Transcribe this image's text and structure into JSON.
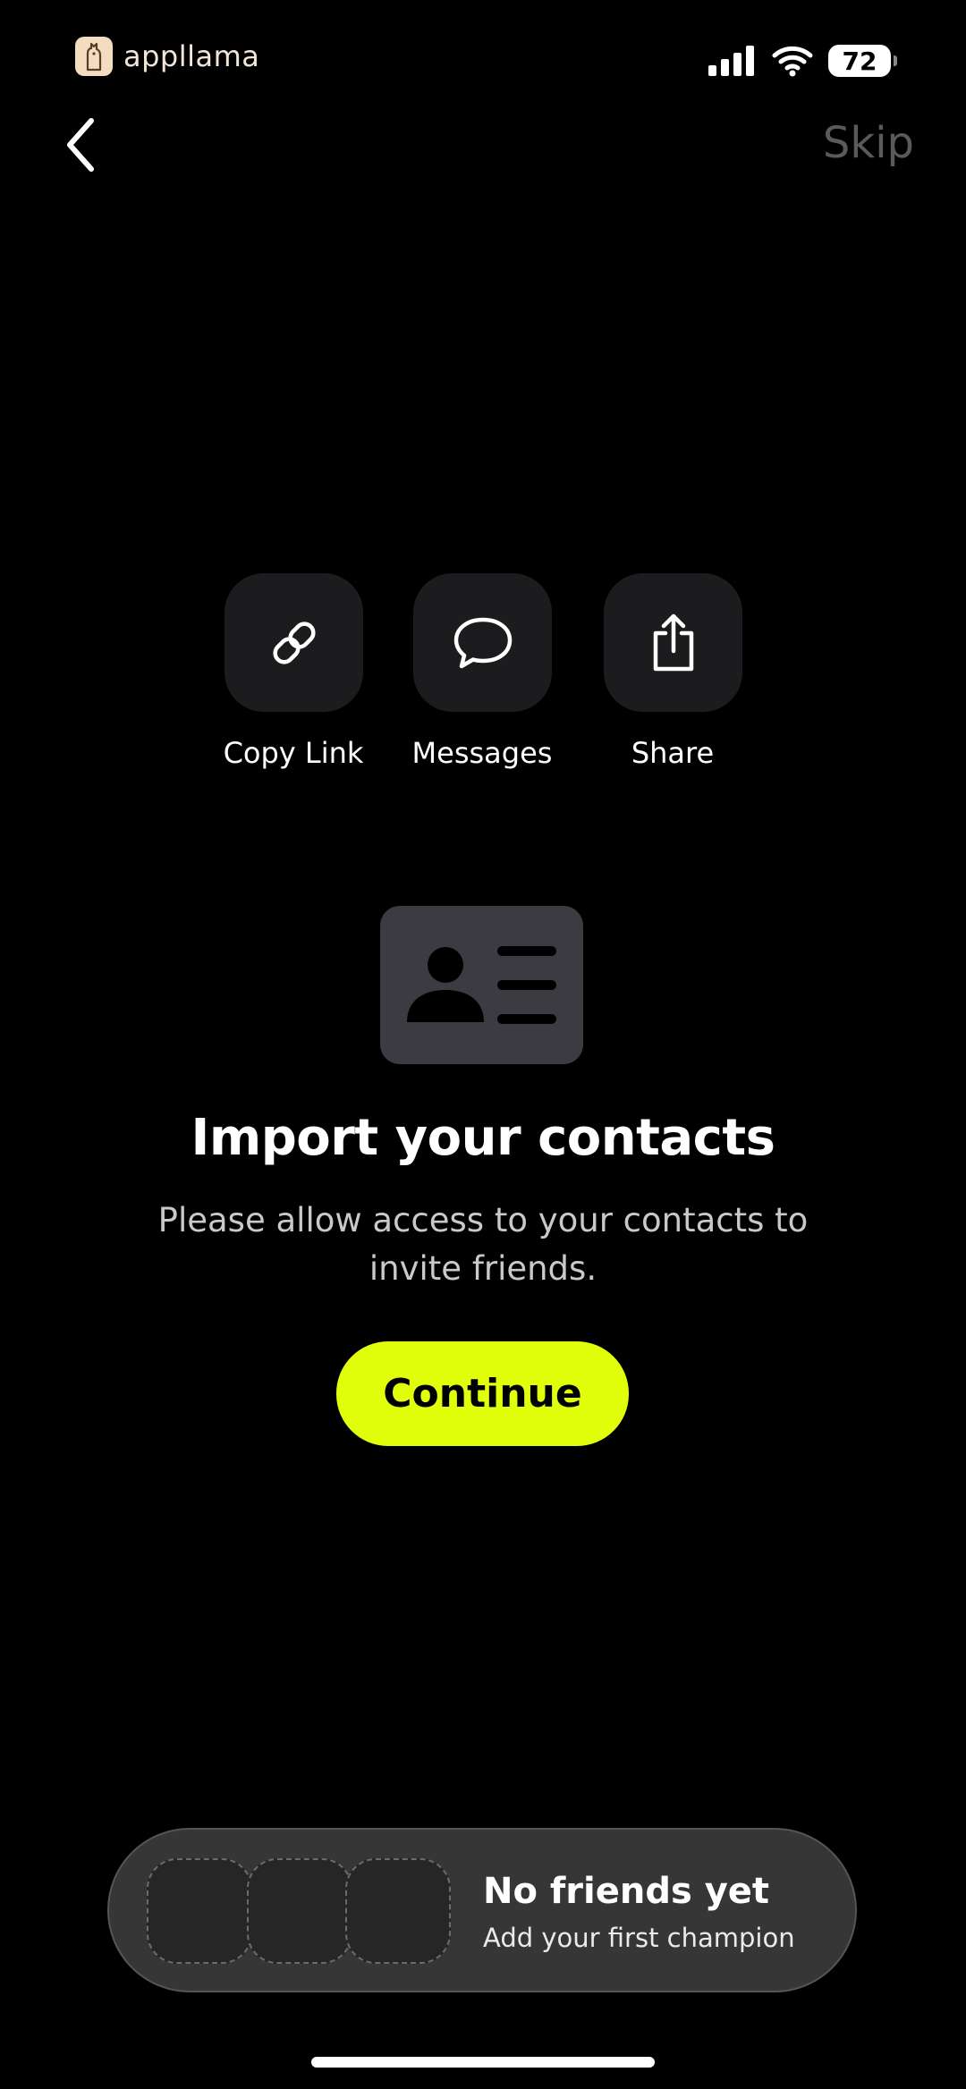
{
  "status_bar": {
    "app_name": "appllama",
    "battery": "72",
    "icons": [
      "cellular-signal-icon",
      "wifi-icon",
      "battery-icon"
    ]
  },
  "nav": {
    "back_icon": "chevron-left-icon",
    "skip_label": "Skip"
  },
  "share_options": [
    {
      "label": "Copy Link",
      "icon": "link-icon"
    },
    {
      "label": "Messages",
      "icon": "message-bubble-icon"
    },
    {
      "label": "Share",
      "icon": "share-icon"
    }
  ],
  "import": {
    "icon": "contact-card-icon",
    "title": "Import your contacts",
    "subtitle": "Please allow access to your contacts to invite friends.",
    "continue_label": "Continue"
  },
  "friends": {
    "title": "No friends yet",
    "subtitle": "Add your first champion"
  },
  "colors": {
    "background": "#000000",
    "accent": "#e1ff0a",
    "tile": "#1c1c1e",
    "card": "#3c3b42",
    "skip": "#5a5a5a"
  }
}
